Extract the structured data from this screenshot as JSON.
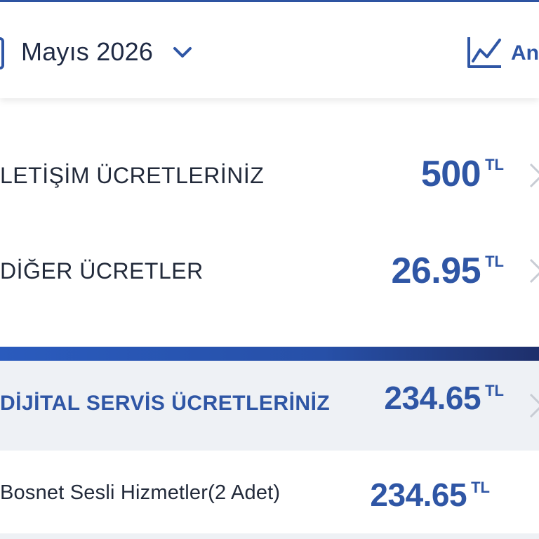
{
  "header": {
    "month": "Mayıs 2026",
    "analysis_label": "An"
  },
  "charges": [
    {
      "label": "LETİŞİM ÜCRETLERİNİZ",
      "amount": "500",
      "currency": "TL"
    },
    {
      "label": "DİĞER ÜCRETLER",
      "amount": "26.95",
      "currency": "TL"
    }
  ],
  "digital": {
    "label": "DİJİTAL SERVİS ÜCRETLERİNİZ",
    "amount": "234.65",
    "currency": "TL"
  },
  "digital_items": [
    {
      "label": "Bosnet Sesli Hizmetler(2 Adet)",
      "amount": "234.65",
      "currency": "TL"
    }
  ],
  "colors": {
    "accent": "#2f56a5",
    "text": "#222a3a",
    "section_bg": "#eef1f5"
  },
  "icons": [
    "calendar-icon",
    "chevron-down-icon",
    "analysis-chart-icon",
    "chevron-right-icon"
  ]
}
